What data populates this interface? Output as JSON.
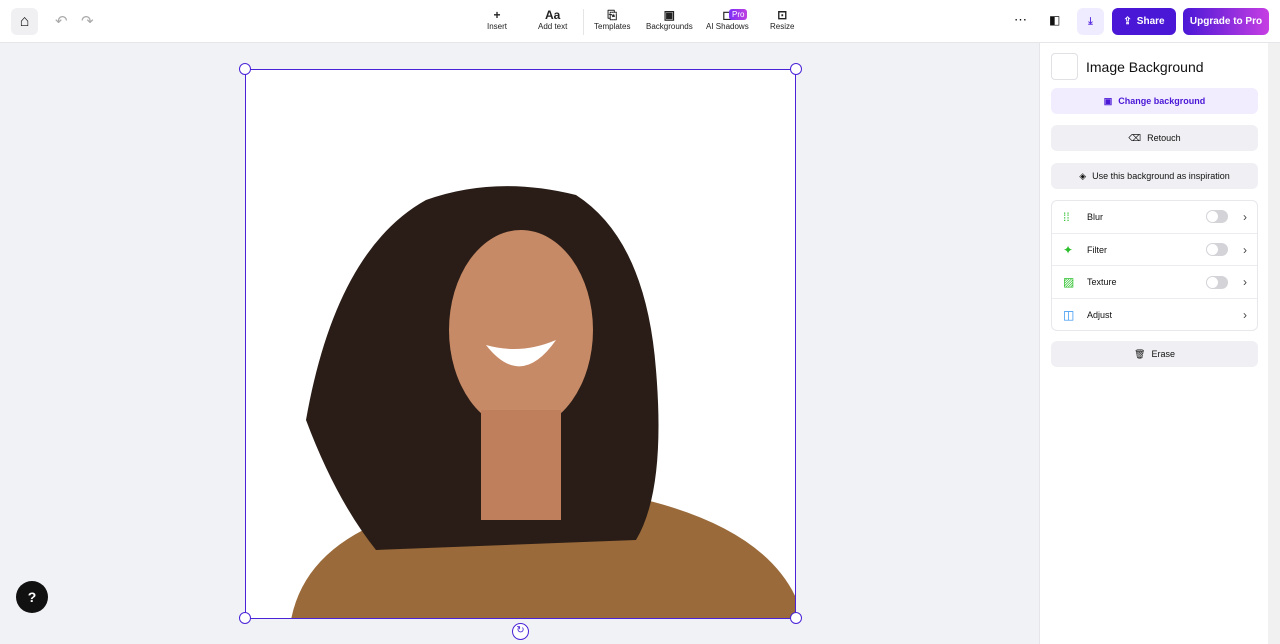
{
  "toolbar": {
    "tools": [
      {
        "label": "Insert",
        "icon": "+"
      },
      {
        "label": "Add text",
        "icon": "Aa"
      },
      {
        "label": "Templates",
        "icon": "⎘"
      },
      {
        "label": "Backgrounds",
        "icon": "▣"
      },
      {
        "label": "AI Shadows",
        "icon": "◻"
      },
      {
        "label": "Resize",
        "icon": "⊡"
      }
    ],
    "pro_badge": "Pro",
    "share": "Share",
    "upgrade": "Upgrade to Pro"
  },
  "panel": {
    "title": "Image Background",
    "change": "Change background",
    "retouch": "Retouch",
    "inspiration": "Use this background as inspiration",
    "options": [
      {
        "label": "Blur",
        "toggle": false
      },
      {
        "label": "Filter",
        "toggle": false
      },
      {
        "label": "Texture",
        "toggle": false
      },
      {
        "label": "Adjust"
      }
    ],
    "erase": "Erase"
  },
  "colors": {
    "accent": "#4a23d8",
    "green": "#2bc02b"
  }
}
